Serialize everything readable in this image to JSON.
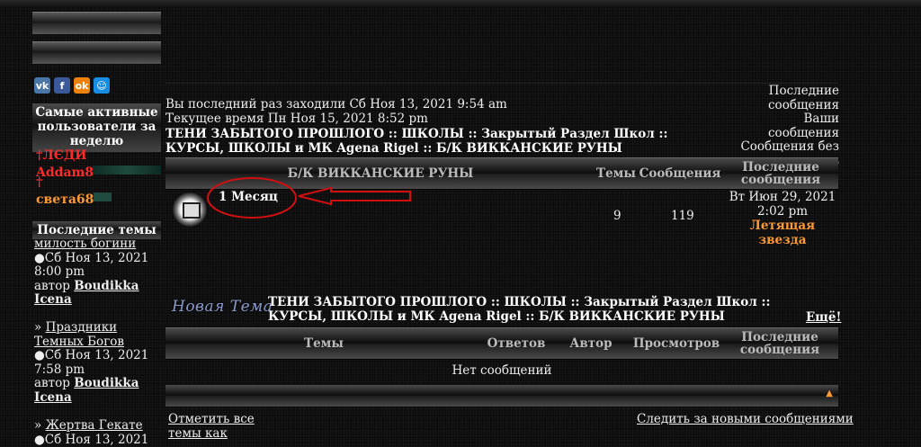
{
  "social": [
    {
      "icon": "vk-icon",
      "glyph": "vk",
      "color": "#4a76a8"
    },
    {
      "icon": "facebook-icon",
      "glyph": "f",
      "color": "#3b5998"
    },
    {
      "icon": "odnoklassniki-icon",
      "glyph": "ok",
      "color": "#ee8208"
    },
    {
      "icon": "moimir-icon",
      "glyph": "☺",
      "color": "#168de2"
    }
  ],
  "sidebar": {
    "active_title": "Самые активные пользователи за неделю",
    "users": [
      {
        "name": "†ЛЄДИ",
        "color": "red"
      },
      {
        "name": "Addam8",
        "color": "red"
      },
      {
        "name": "†",
        "color": "red"
      },
      {
        "name": "света68",
        "color": "orange"
      }
    ],
    "latest_title": "Последние темы",
    "topics": [
      {
        "title": "милость богини",
        "date": "Сб Ноя 13, 2021",
        "time": "8:00 pm",
        "by": "автор",
        "author": "Boudikka Icena"
      },
      {
        "title": "Праздники Темных Богов",
        "date": "Сб Ноя 13, 2021",
        "time": "7:58 pm",
        "by": "автор",
        "author": "Boudikka Icena"
      },
      {
        "title": "Жертва Гекате",
        "date": "Сб Ноя 13, 2021",
        "time": "",
        "by": "",
        "author": ""
      }
    ],
    "topic_prefix": "» "
  },
  "info": {
    "last_visit": "Вы последний раз заходили Сб Ноя 13, 2021 9:54 am",
    "current_time": "Текущее время Пн Ноя 15, 2021 8:52 pm"
  },
  "breadcrumb": "ТЕНИ ЗАБЫТОГО ПРОШЛОГО :: ШКОЛЫ :: Закрытый Раздел Школ :: КУРСЫ, ШКОЛЫ и МК Agena Rigel :: Б/К ВИККАНСКИЕ РУНЫ",
  "right_links": {
    "latest_posts": "Последние сообщения",
    "your_posts": "Ваши сообщения",
    "unanswered": "Сообщения без ответов"
  },
  "forum_table": {
    "headers": {
      "forum": "Б/К ВИККАНСКИЕ РУНЫ",
      "topics": "Темы",
      "posts": "Сообщения",
      "last": "Последние сообщения"
    },
    "row": {
      "name": "1 Месяц",
      "topics": "9",
      "posts": "119",
      "last_date": "Вт Июн 29, 2021",
      "last_time": "2:02 pm",
      "last_author": "Летящая звезда"
    }
  },
  "new_topic": {
    "label": "Новая Тема",
    "more": "Ещё!"
  },
  "topics_table": {
    "headers": {
      "topics": "Темы",
      "replies": "Ответов",
      "author": "Автор",
      "views": "Просмотров",
      "last": "Последние сообщения"
    },
    "empty": "Нет сообщений"
  },
  "footer": {
    "mark_read": "Отметить все темы как",
    "watch": "Следить за новыми сообщениями"
  },
  "colors": {
    "annotation": "#d01010",
    "author_link": "#4466ff",
    "highlight": "#ff9933"
  }
}
